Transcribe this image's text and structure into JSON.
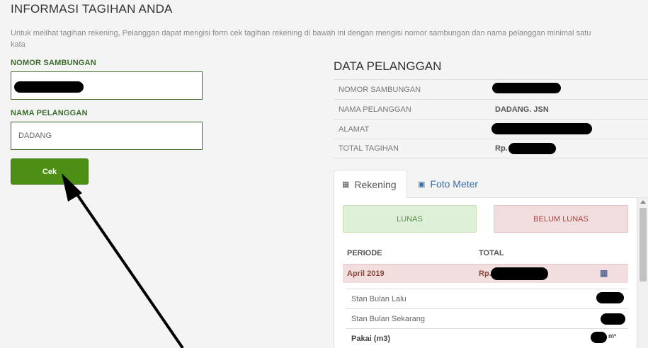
{
  "header": {
    "title": "INFORMASI TAGIHAN ANDA",
    "intro": "Untuk melihat tagihan rekening, Pelanggan dapat mengisi form cek tagihan rekening di bawah ini dengan mengisi nomor sambungan dan nama pelanggan minimal satu kata"
  },
  "form": {
    "nomor_label": "NOMOR SAMBUNGAN",
    "nomor_value": "",
    "nama_label": "NAMA PELANGGAN",
    "nama_value": "DADANG",
    "submit_label": "Cek"
  },
  "customer": {
    "title": "DATA PELANGGAN",
    "rows": [
      {
        "key": "NOMOR SAMBUNGAN",
        "value": ""
      },
      {
        "key": "NAMA PELANGGAN",
        "value": "DADANG. JSN"
      },
      {
        "key": "ALAMAT",
        "value": ""
      },
      {
        "key": "TOTAL TAGIHAN",
        "value": "Rp."
      }
    ]
  },
  "tabs": {
    "rekening": "Rekening",
    "foto_meter": "Foto Meter",
    "active": "Rekening"
  },
  "billing": {
    "lunas_label": "LUNAS",
    "belum_lunas_label": "BELUM LUNAS",
    "col_periode": "PERIODE",
    "col_total": "TOTAL",
    "period": "April 2019",
    "period_total_prefix": "Rp.",
    "details": {
      "stan_lalu": "Stan Bulan Lalu",
      "stan_sekarang": "Stan Bulan Sekarang",
      "pakai": "Pakai (m3)",
      "pakai_unit": "m²"
    }
  },
  "icons": {
    "rekening_tab": "calculator-icon",
    "foto_meter_tab": "camera-icon",
    "period_row": "calculator-icon"
  },
  "colors": {
    "primary_green": "#4d8f14",
    "label_green": "#3d6b2e",
    "lunas_bg": "#dff0d8",
    "belum_bg": "#f2dede",
    "link_blue": "#3a6ea5"
  }
}
